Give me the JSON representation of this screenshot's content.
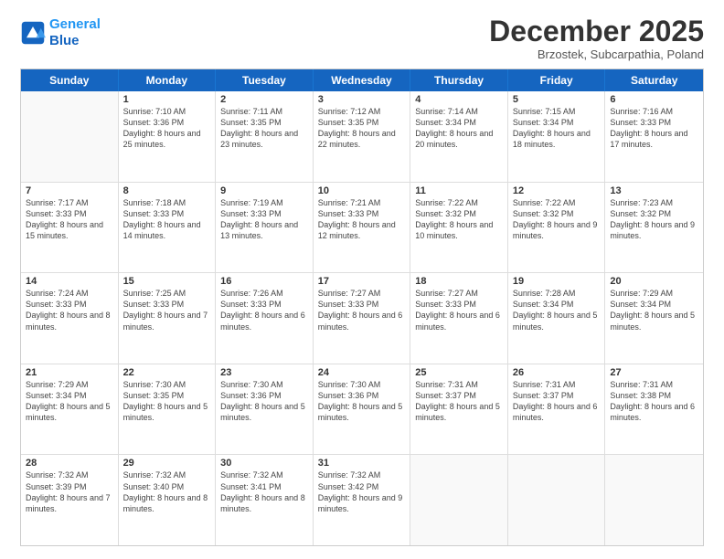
{
  "logo": {
    "line1": "General",
    "line2": "Blue"
  },
  "title": "December 2025",
  "subtitle": "Brzostek, Subcarpathia, Poland",
  "header_days": [
    "Sunday",
    "Monday",
    "Tuesday",
    "Wednesday",
    "Thursday",
    "Friday",
    "Saturday"
  ],
  "rows": [
    [
      {
        "day": "",
        "empty": true
      },
      {
        "day": "1",
        "sunrise": "Sunrise: 7:10 AM",
        "sunset": "Sunset: 3:36 PM",
        "daylight": "Daylight: 8 hours and 25 minutes."
      },
      {
        "day": "2",
        "sunrise": "Sunrise: 7:11 AM",
        "sunset": "Sunset: 3:35 PM",
        "daylight": "Daylight: 8 hours and 23 minutes."
      },
      {
        "day": "3",
        "sunrise": "Sunrise: 7:12 AM",
        "sunset": "Sunset: 3:35 PM",
        "daylight": "Daylight: 8 hours and 22 minutes."
      },
      {
        "day": "4",
        "sunrise": "Sunrise: 7:14 AM",
        "sunset": "Sunset: 3:34 PM",
        "daylight": "Daylight: 8 hours and 20 minutes."
      },
      {
        "day": "5",
        "sunrise": "Sunrise: 7:15 AM",
        "sunset": "Sunset: 3:34 PM",
        "daylight": "Daylight: 8 hours and 18 minutes."
      },
      {
        "day": "6",
        "sunrise": "Sunrise: 7:16 AM",
        "sunset": "Sunset: 3:33 PM",
        "daylight": "Daylight: 8 hours and 17 minutes."
      }
    ],
    [
      {
        "day": "7",
        "sunrise": "Sunrise: 7:17 AM",
        "sunset": "Sunset: 3:33 PM",
        "daylight": "Daylight: 8 hours and 15 minutes."
      },
      {
        "day": "8",
        "sunrise": "Sunrise: 7:18 AM",
        "sunset": "Sunset: 3:33 PM",
        "daylight": "Daylight: 8 hours and 14 minutes."
      },
      {
        "day": "9",
        "sunrise": "Sunrise: 7:19 AM",
        "sunset": "Sunset: 3:33 PM",
        "daylight": "Daylight: 8 hours and 13 minutes."
      },
      {
        "day": "10",
        "sunrise": "Sunrise: 7:21 AM",
        "sunset": "Sunset: 3:33 PM",
        "daylight": "Daylight: 8 hours and 12 minutes."
      },
      {
        "day": "11",
        "sunrise": "Sunrise: 7:22 AM",
        "sunset": "Sunset: 3:32 PM",
        "daylight": "Daylight: 8 hours and 10 minutes."
      },
      {
        "day": "12",
        "sunrise": "Sunrise: 7:22 AM",
        "sunset": "Sunset: 3:32 PM",
        "daylight": "Daylight: 8 hours and 9 minutes."
      },
      {
        "day": "13",
        "sunrise": "Sunrise: 7:23 AM",
        "sunset": "Sunset: 3:32 PM",
        "daylight": "Daylight: 8 hours and 9 minutes."
      }
    ],
    [
      {
        "day": "14",
        "sunrise": "Sunrise: 7:24 AM",
        "sunset": "Sunset: 3:33 PM",
        "daylight": "Daylight: 8 hours and 8 minutes."
      },
      {
        "day": "15",
        "sunrise": "Sunrise: 7:25 AM",
        "sunset": "Sunset: 3:33 PM",
        "daylight": "Daylight: 8 hours and 7 minutes."
      },
      {
        "day": "16",
        "sunrise": "Sunrise: 7:26 AM",
        "sunset": "Sunset: 3:33 PM",
        "daylight": "Daylight: 8 hours and 6 minutes."
      },
      {
        "day": "17",
        "sunrise": "Sunrise: 7:27 AM",
        "sunset": "Sunset: 3:33 PM",
        "daylight": "Daylight: 8 hours and 6 minutes."
      },
      {
        "day": "18",
        "sunrise": "Sunrise: 7:27 AM",
        "sunset": "Sunset: 3:33 PM",
        "daylight": "Daylight: 8 hours and 6 minutes."
      },
      {
        "day": "19",
        "sunrise": "Sunrise: 7:28 AM",
        "sunset": "Sunset: 3:34 PM",
        "daylight": "Daylight: 8 hours and 5 minutes."
      },
      {
        "day": "20",
        "sunrise": "Sunrise: 7:29 AM",
        "sunset": "Sunset: 3:34 PM",
        "daylight": "Daylight: 8 hours and 5 minutes."
      }
    ],
    [
      {
        "day": "21",
        "sunrise": "Sunrise: 7:29 AM",
        "sunset": "Sunset: 3:34 PM",
        "daylight": "Daylight: 8 hours and 5 minutes."
      },
      {
        "day": "22",
        "sunrise": "Sunrise: 7:30 AM",
        "sunset": "Sunset: 3:35 PM",
        "daylight": "Daylight: 8 hours and 5 minutes."
      },
      {
        "day": "23",
        "sunrise": "Sunrise: 7:30 AM",
        "sunset": "Sunset: 3:36 PM",
        "daylight": "Daylight: 8 hours and 5 minutes."
      },
      {
        "day": "24",
        "sunrise": "Sunrise: 7:30 AM",
        "sunset": "Sunset: 3:36 PM",
        "daylight": "Daylight: 8 hours and 5 minutes."
      },
      {
        "day": "25",
        "sunrise": "Sunrise: 7:31 AM",
        "sunset": "Sunset: 3:37 PM",
        "daylight": "Daylight: 8 hours and 5 minutes."
      },
      {
        "day": "26",
        "sunrise": "Sunrise: 7:31 AM",
        "sunset": "Sunset: 3:37 PM",
        "daylight": "Daylight: 8 hours and 6 minutes."
      },
      {
        "day": "27",
        "sunrise": "Sunrise: 7:31 AM",
        "sunset": "Sunset: 3:38 PM",
        "daylight": "Daylight: 8 hours and 6 minutes."
      }
    ],
    [
      {
        "day": "28",
        "sunrise": "Sunrise: 7:32 AM",
        "sunset": "Sunset: 3:39 PM",
        "daylight": "Daylight: 8 hours and 7 minutes."
      },
      {
        "day": "29",
        "sunrise": "Sunrise: 7:32 AM",
        "sunset": "Sunset: 3:40 PM",
        "daylight": "Daylight: 8 hours and 8 minutes."
      },
      {
        "day": "30",
        "sunrise": "Sunrise: 7:32 AM",
        "sunset": "Sunset: 3:41 PM",
        "daylight": "Daylight: 8 hours and 8 minutes."
      },
      {
        "day": "31",
        "sunrise": "Sunrise: 7:32 AM",
        "sunset": "Sunset: 3:42 PM",
        "daylight": "Daylight: 8 hours and 9 minutes."
      },
      {
        "day": "",
        "empty": true
      },
      {
        "day": "",
        "empty": true
      },
      {
        "day": "",
        "empty": true
      }
    ]
  ]
}
